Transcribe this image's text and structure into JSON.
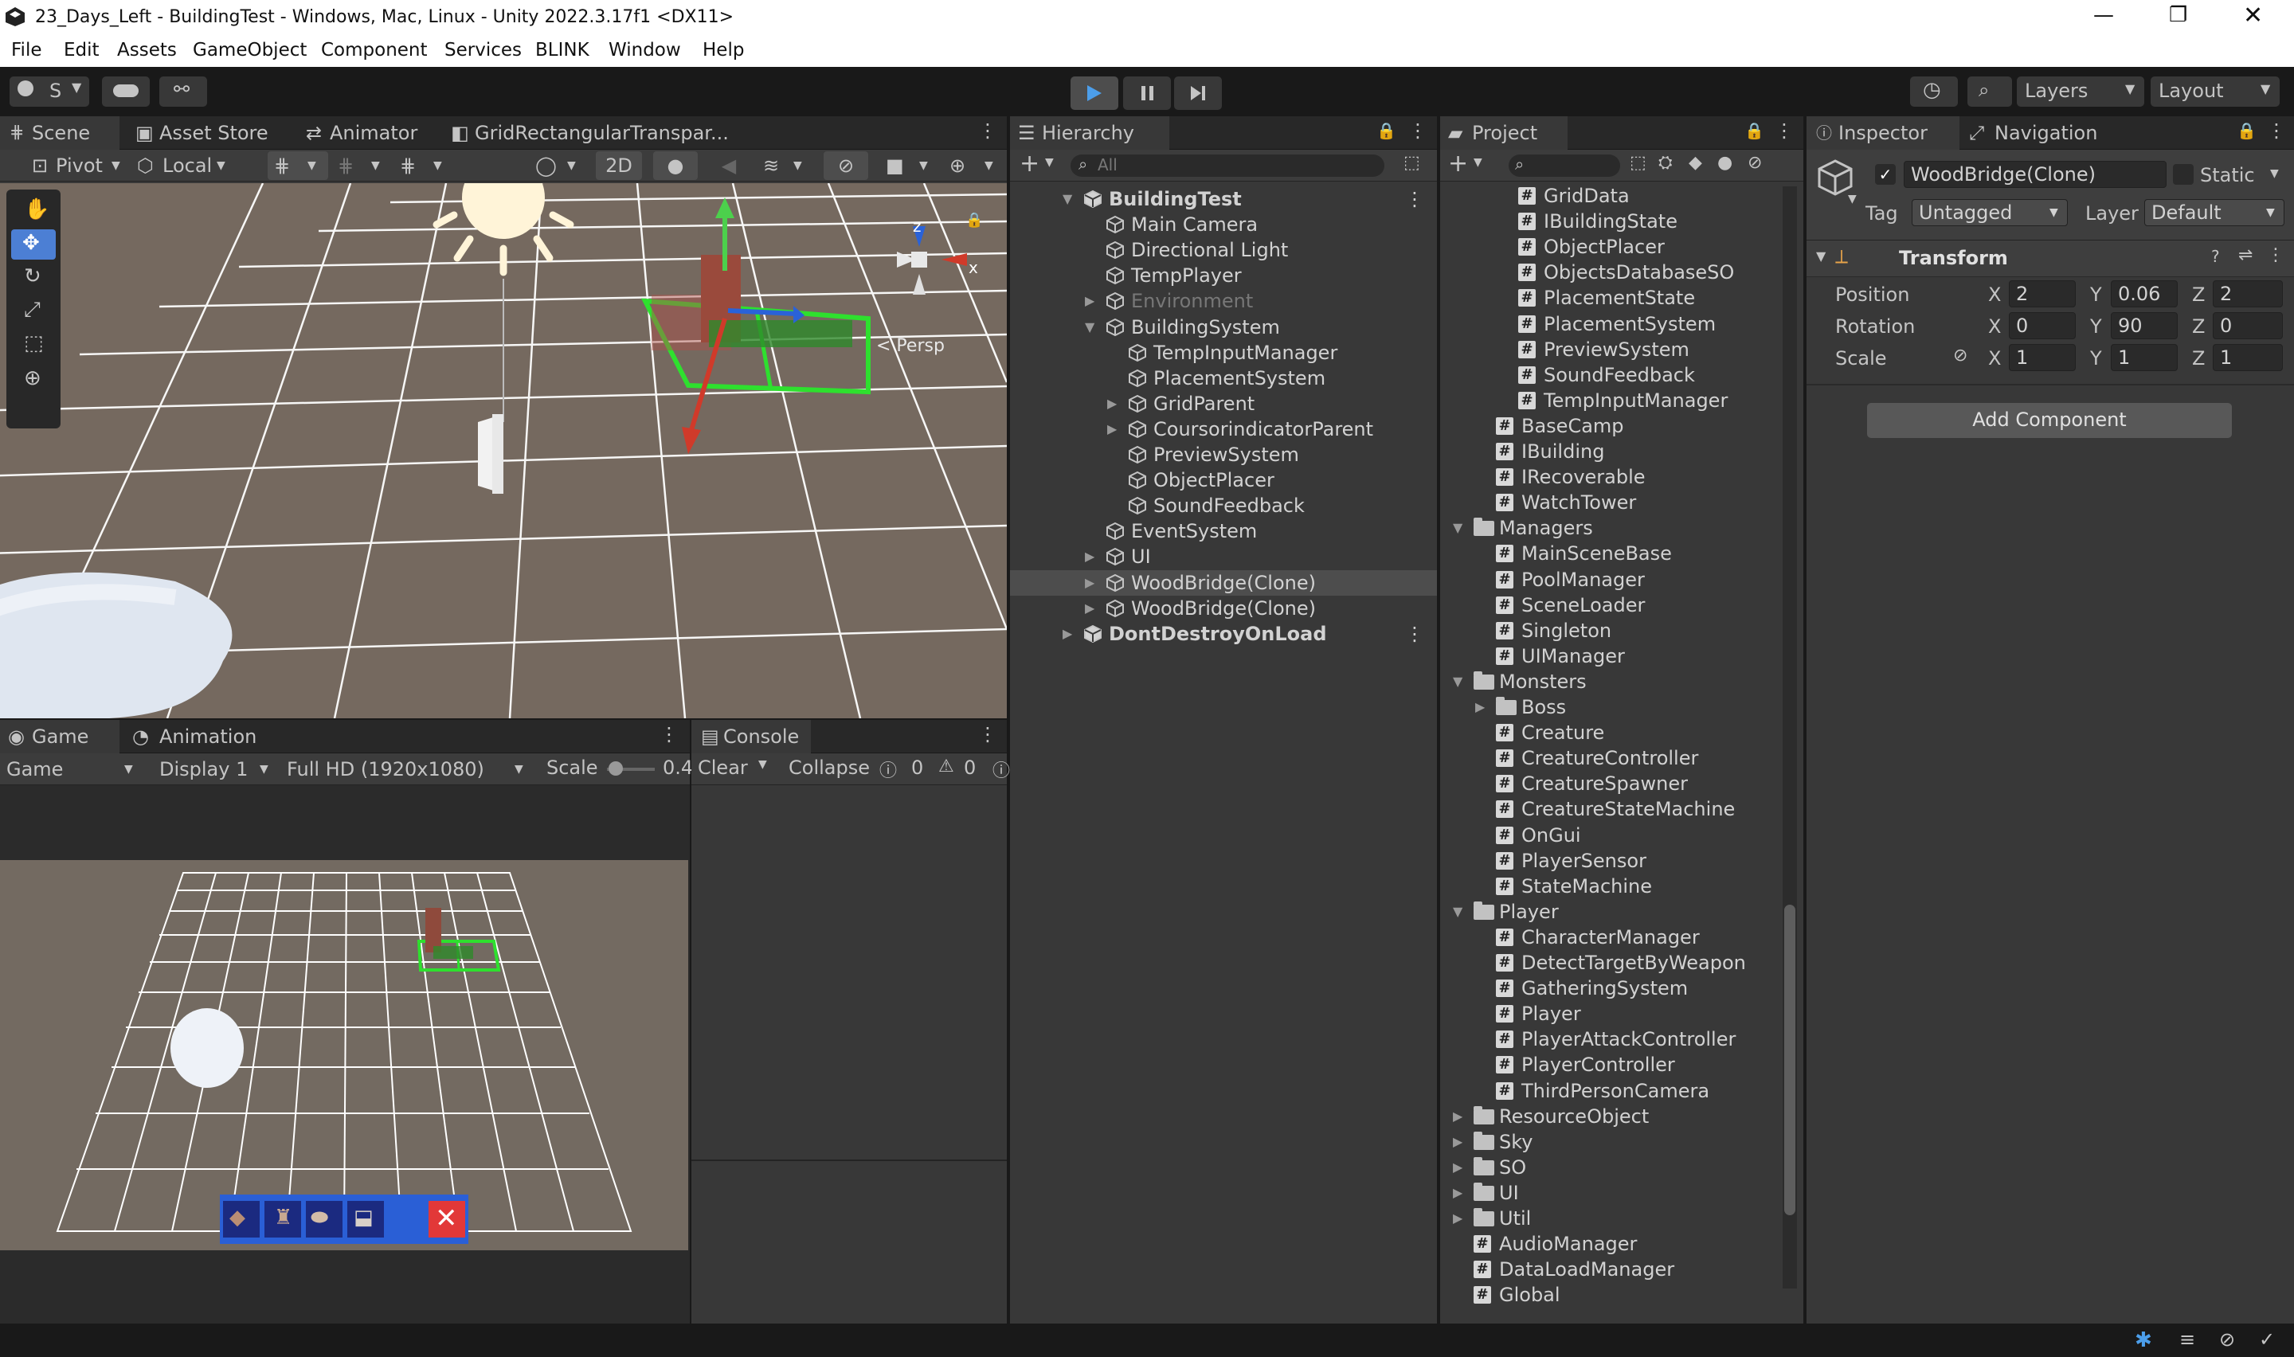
{
  "window": {
    "title": "23_Days_Left - BuildingTest - Windows, Mac, Linux - Unity 2022.3.17f1 <DX11>",
    "controls": [
      "—",
      "❐",
      "✕"
    ]
  },
  "menu": [
    "File",
    "Edit",
    "Assets",
    "GameObject",
    "Component",
    "Services",
    "BLINK",
    "Window",
    "Help"
  ],
  "toolbar": {
    "account": "S",
    "layers": "Layers",
    "layout": "Layout"
  },
  "scene_panel": {
    "tabs": [
      "Scene",
      "Asset Store",
      "Animator",
      "GridRectangularTranspar..."
    ],
    "pivot": "Pivot",
    "local": "Local",
    "mode_2d": "2D",
    "persp": "< Persp",
    "gizmo_axes": {
      "z": "z",
      "x": "x"
    }
  },
  "game_panel": {
    "tabs": [
      "Game",
      "Animation"
    ],
    "mode": "Game",
    "display": "Display 1",
    "resolution": "Full HD (1920x1080)",
    "scale_label": "Scale",
    "scale_value": "0.4"
  },
  "console_panel": {
    "tab": "Console",
    "clear": "Clear",
    "collapse": "Collapse",
    "info_count": "0",
    "warn_count": "0"
  },
  "hierarchy": {
    "tab": "Hierarchy",
    "search_placeholder": "All",
    "items": [
      {
        "label": "BuildingTest",
        "depth": 0,
        "expand": "down",
        "type": "scene"
      },
      {
        "label": "Main Camera",
        "depth": 1,
        "type": "object"
      },
      {
        "label": "Directional Light",
        "depth": 1,
        "type": "object"
      },
      {
        "label": "TempPlayer",
        "depth": 1,
        "type": "object"
      },
      {
        "label": "Environment",
        "depth": 1,
        "expand": "right",
        "type": "object",
        "disabled": true
      },
      {
        "label": "BuildingSystem",
        "depth": 1,
        "expand": "down",
        "type": "object"
      },
      {
        "label": "TempInputManager",
        "depth": 2,
        "type": "object"
      },
      {
        "label": "PlacementSystem",
        "depth": 2,
        "type": "object"
      },
      {
        "label": "GridParent",
        "depth": 2,
        "expand": "right",
        "type": "object"
      },
      {
        "label": "CoursorindicatorParent",
        "depth": 2,
        "expand": "right",
        "type": "object"
      },
      {
        "label": "PreviewSystem",
        "depth": 2,
        "type": "object"
      },
      {
        "label": "ObjectPlacer",
        "depth": 2,
        "type": "object"
      },
      {
        "label": "SoundFeedback",
        "depth": 2,
        "type": "object"
      },
      {
        "label": "EventSystem",
        "depth": 1,
        "type": "object"
      },
      {
        "label": "UI",
        "depth": 1,
        "expand": "right",
        "type": "object"
      },
      {
        "label": "WoodBridge(Clone)",
        "depth": 1,
        "expand": "right",
        "type": "object",
        "selected": true
      },
      {
        "label": "WoodBridge(Clone)",
        "depth": 1,
        "expand": "right",
        "type": "object"
      },
      {
        "label": "DontDestroyOnLoad",
        "depth": 0,
        "expand": "right",
        "type": "scene"
      }
    ]
  },
  "project": {
    "tab": "Project",
    "items": [
      {
        "label": "GridData",
        "depth": 3,
        "type": "script"
      },
      {
        "label": "IBuildingState",
        "depth": 3,
        "type": "script"
      },
      {
        "label": "ObjectPlacer",
        "depth": 3,
        "type": "script"
      },
      {
        "label": "ObjectsDatabaseSO",
        "depth": 3,
        "type": "script"
      },
      {
        "label": "PlacementState",
        "depth": 3,
        "type": "script"
      },
      {
        "label": "PlacementSystem",
        "depth": 3,
        "type": "script"
      },
      {
        "label": "PreviewSystem",
        "depth": 3,
        "type": "script"
      },
      {
        "label": "SoundFeedback",
        "depth": 3,
        "type": "script"
      },
      {
        "label": "TempInputManager",
        "depth": 3,
        "type": "script"
      },
      {
        "label": "BaseCamp",
        "depth": 2,
        "type": "script"
      },
      {
        "label": "IBuilding",
        "depth": 2,
        "type": "script"
      },
      {
        "label": "IRecoverable",
        "depth": 2,
        "type": "script"
      },
      {
        "label": "WatchTower",
        "depth": 2,
        "type": "script"
      },
      {
        "label": "Managers",
        "depth": 1,
        "type": "folder",
        "expand": "down"
      },
      {
        "label": "MainSceneBase",
        "depth": 2,
        "type": "script"
      },
      {
        "label": "PoolManager",
        "depth": 2,
        "type": "script"
      },
      {
        "label": "SceneLoader",
        "depth": 2,
        "type": "script"
      },
      {
        "label": "Singleton",
        "depth": 2,
        "type": "script"
      },
      {
        "label": "UIManager",
        "depth": 2,
        "type": "script"
      },
      {
        "label": "Monsters",
        "depth": 1,
        "type": "folder",
        "expand": "down"
      },
      {
        "label": "Boss",
        "depth": 2,
        "type": "folder",
        "expand": "right"
      },
      {
        "label": "Creature",
        "depth": 2,
        "type": "script"
      },
      {
        "label": "CreatureController",
        "depth": 2,
        "type": "script"
      },
      {
        "label": "CreatureSpawner",
        "depth": 2,
        "type": "script"
      },
      {
        "label": "CreatureStateMachine",
        "depth": 2,
        "type": "script"
      },
      {
        "label": "OnGui",
        "depth": 2,
        "type": "script"
      },
      {
        "label": "PlayerSensor",
        "depth": 2,
        "type": "script"
      },
      {
        "label": "StateMachine",
        "depth": 2,
        "type": "script"
      },
      {
        "label": "Player",
        "depth": 1,
        "type": "folder",
        "expand": "down"
      },
      {
        "label": "CharacterManager",
        "depth": 2,
        "type": "script"
      },
      {
        "label": "DetectTargetByWeapon",
        "depth": 2,
        "type": "script"
      },
      {
        "label": "GatheringSystem",
        "depth": 2,
        "type": "script"
      },
      {
        "label": "Player",
        "depth": 2,
        "type": "script"
      },
      {
        "label": "PlayerAttackController",
        "depth": 2,
        "type": "script"
      },
      {
        "label": "PlayerController",
        "depth": 2,
        "type": "script"
      },
      {
        "label": "ThirdPersonCamera",
        "depth": 2,
        "type": "script"
      },
      {
        "label": "ResourceObject",
        "depth": 1,
        "type": "folder",
        "expand": "right"
      },
      {
        "label": "Sky",
        "depth": 1,
        "type": "folder",
        "expand": "right"
      },
      {
        "label": "SO",
        "depth": 1,
        "type": "folder",
        "expand": "right"
      },
      {
        "label": "UI",
        "depth": 1,
        "type": "folder",
        "expand": "right"
      },
      {
        "label": "Util",
        "depth": 1,
        "type": "folder",
        "expand": "right"
      },
      {
        "label": "AudioManager",
        "depth": 1,
        "type": "script"
      },
      {
        "label": "DataLoadManager",
        "depth": 1,
        "type": "script"
      },
      {
        "label": "Global",
        "depth": 1,
        "type": "script"
      }
    ]
  },
  "inspector": {
    "tabs": [
      "Inspector",
      "Navigation (Obsolete)"
    ],
    "object_name": "WoodBridge(Clone)",
    "static_label": "Static",
    "tag_label": "Tag",
    "tag_value": "Untagged",
    "layer_label": "Layer",
    "layer_value": "Default",
    "component_title": "Transform",
    "position": {
      "label": "Position",
      "x": "2",
      "y": "0.06",
      "z": "2"
    },
    "rotation": {
      "label": "Rotation",
      "x": "0",
      "y": "90",
      "z": "0"
    },
    "scale": {
      "label": "Scale",
      "x": "1",
      "y": "1",
      "z": "1"
    },
    "axis": {
      "x": "X",
      "y": "Y",
      "z": "Z"
    },
    "add_component": "Add Component"
  },
  "colors": {
    "panel_bg": "#383838",
    "tab_bg": "#282828",
    "selected_row": "#4d4d4d",
    "accent_blue": "#4c7fd4",
    "grid_green": "#2ee02e",
    "scene_ground": "#7a7068"
  }
}
